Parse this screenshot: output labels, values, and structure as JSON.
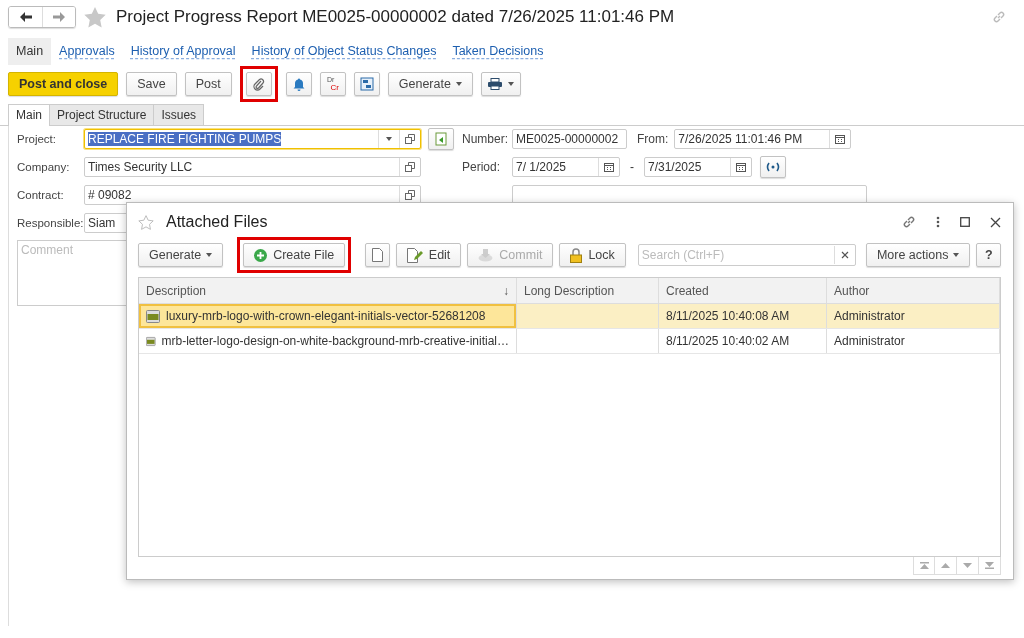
{
  "window": {
    "title": "Project Progress Report ME0025-00000002 dated 7/26/2025 11:01:46 PM"
  },
  "nav_links": [
    {
      "label": "Main",
      "selected": true
    },
    {
      "label": "Approvals",
      "selected": false
    },
    {
      "label": "History of Approval",
      "selected": false
    },
    {
      "label": "History of Object Status Changes",
      "selected": false
    },
    {
      "label": "Taken Decisions",
      "selected": false
    }
  ],
  "toolbar": [
    {
      "kind": "primary",
      "label": "Post and close"
    },
    {
      "kind": "button",
      "label": "Save"
    },
    {
      "kind": "button",
      "label": "Post"
    },
    {
      "kind": "attach",
      "highlighted": true
    },
    {
      "kind": "bell"
    },
    {
      "kind": "drcr",
      "top": "Dr",
      "bottom": "Cr"
    },
    {
      "kind": "structure"
    },
    {
      "kind": "dropdown",
      "label": "Generate"
    },
    {
      "kind": "print"
    }
  ],
  "tabs": [
    {
      "label": "Main",
      "selected": true
    },
    {
      "label": "Project Structure",
      "selected": false
    },
    {
      "label": "Issues",
      "selected": false
    }
  ],
  "left_fields": [
    {
      "label": "Project:",
      "value": "REPLACE FIRE FIGHTING PUMPS",
      "focused": true,
      "text_selected": true,
      "dropdown": true
    },
    {
      "label": "Company:",
      "value": "Times Security LLC",
      "focused": false,
      "text_selected": false,
      "dropdown": false
    },
    {
      "label": "Contract:",
      "value": "# 09082",
      "focused": false,
      "text_selected": false,
      "dropdown": false
    },
    {
      "label": "Responsible:",
      "value": "Siam",
      "focused": false,
      "text_selected": false,
      "dropdown": false
    }
  ],
  "comment": {
    "placeholder": "Comment"
  },
  "number": {
    "label": "Number:",
    "value": "ME0025-00000002"
  },
  "from": {
    "label": "From:",
    "value": "7/26/2025 11:01:46 PM"
  },
  "period": {
    "label": "Period:",
    "start": "7/ 1/2025",
    "separator": "-",
    "end": "7/31/2025"
  },
  "dialog": {
    "title": "Attached Files",
    "toolbar": [
      {
        "kind": "dropdown",
        "label": "Generate",
        "disabled": false
      },
      {
        "kind": "create",
        "label": "Create File",
        "disabled": false,
        "highlighted": true
      },
      {
        "kind": "blank",
        "disabled": false
      },
      {
        "kind": "edit",
        "label": "Edit",
        "disabled": false
      },
      {
        "kind": "commit",
        "label": "Commit",
        "disabled": true
      },
      {
        "kind": "lock",
        "label": "Lock",
        "disabled": false
      }
    ],
    "search": {
      "placeholder": "Search (Ctrl+F)"
    },
    "more_actions": "More actions",
    "help": "?",
    "columns": [
      {
        "label": "Description",
        "sort": "↓"
      },
      {
        "label": "Long Description"
      },
      {
        "label": "Created"
      },
      {
        "label": "Author"
      }
    ],
    "rows": [
      {
        "description": "luxury-mrb-logo-with-crown-elegant-initials-vector-52681208",
        "created": "8/11/2025 10:40:08 AM",
        "author": "Administrator",
        "selected": true
      },
      {
        "description": "mrb-letter-logo-design-on-white-background-mrb-creative-initial…",
        "created": "8/11/2025 10:40:02 AM",
        "author": "Administrator",
        "selected": false
      }
    ]
  }
}
